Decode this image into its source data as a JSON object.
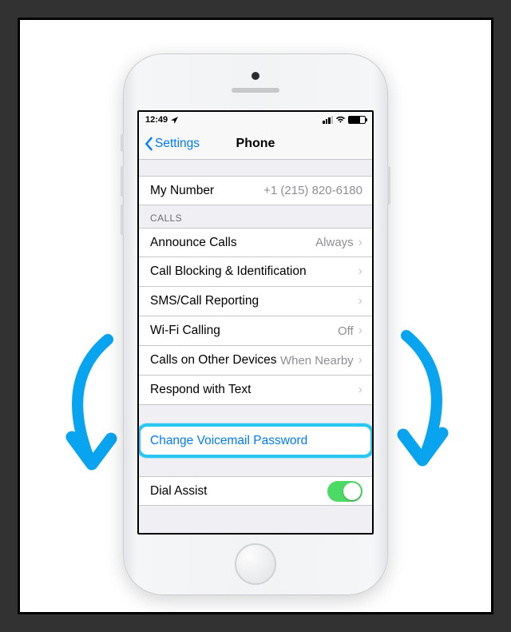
{
  "status": {
    "time": "12:49",
    "carrier_signal_bars": 3,
    "battery_pct": 70
  },
  "nav": {
    "back_label": "Settings",
    "title": "Phone"
  },
  "my_number": {
    "label": "My Number",
    "value": "+1 (215) 820-6180"
  },
  "calls_header": "CALLS",
  "calls": {
    "announce": {
      "label": "Announce Calls",
      "value": "Always"
    },
    "blocking": {
      "label": "Call Blocking & Identification"
    },
    "reporting": {
      "label": "SMS/Call Reporting"
    },
    "wifi": {
      "label": "Wi-Fi Calling",
      "value": "Off"
    },
    "other_devices": {
      "label": "Calls on Other Devices",
      "value": "When Nearby"
    },
    "respond": {
      "label": "Respond with Text"
    }
  },
  "voicemail": {
    "label": "Change Voicemail Password"
  },
  "dial_assist": {
    "label": "Dial Assist",
    "enabled": true
  },
  "accent_color": "#007aff",
  "arrow_color": "#09a4f0",
  "highlight_color": "#29c6f2"
}
